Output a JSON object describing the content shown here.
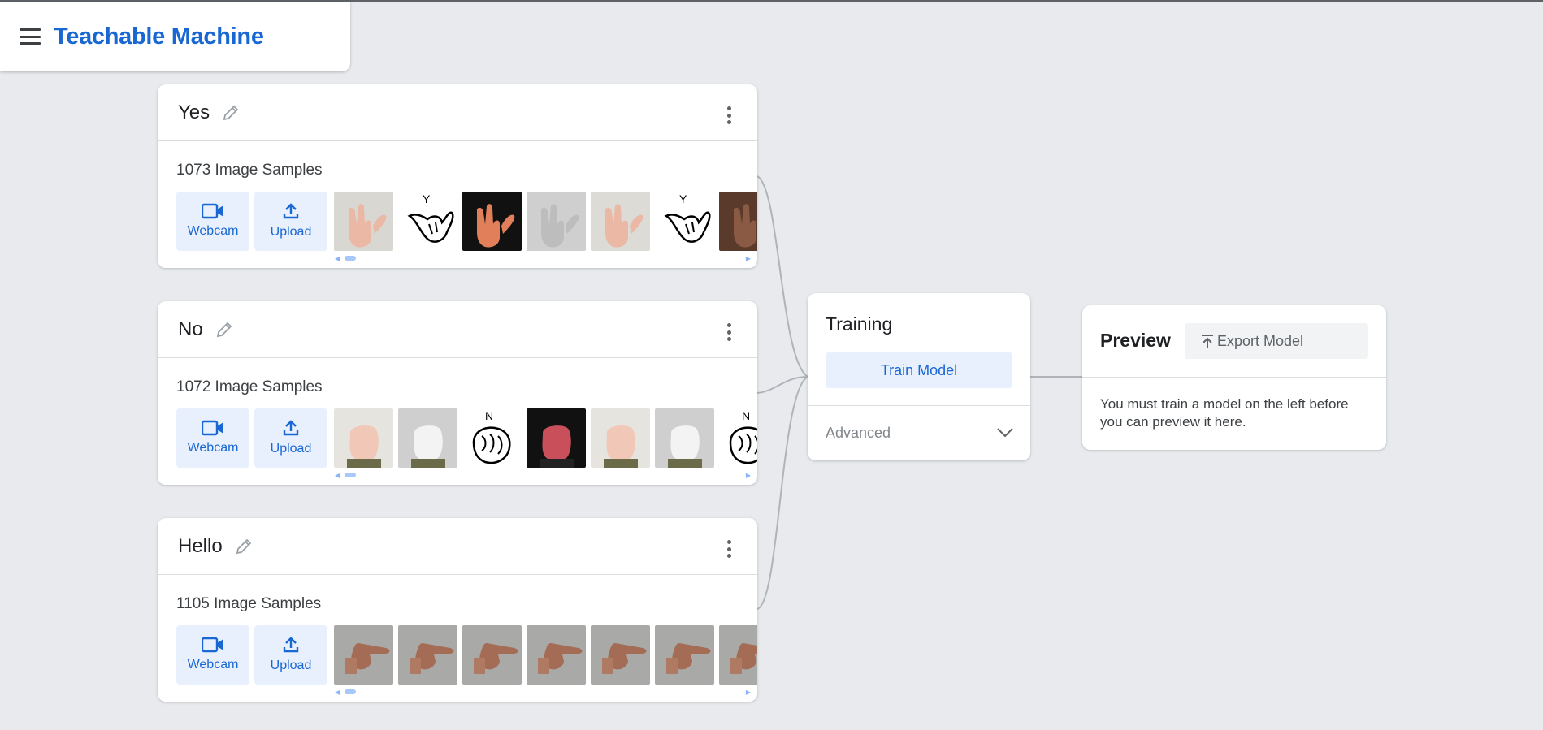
{
  "app": {
    "title": "Teachable Machine"
  },
  "classes": [
    {
      "name": "Yes",
      "sample_count": "1073 Image Samples",
      "webcam_label": "Webcam",
      "upload_label": "Upload"
    },
    {
      "name": "No",
      "sample_count": "1072 Image Samples",
      "webcam_label": "Webcam",
      "upload_label": "Upload"
    },
    {
      "name": "Hello",
      "sample_count": "1105 Image Samples",
      "webcam_label": "Webcam",
      "upload_label": "Upload"
    }
  ],
  "training": {
    "title": "Training",
    "train_button": "Train Model",
    "advanced_label": "Advanced"
  },
  "preview": {
    "title": "Preview",
    "export_button": "Export Model",
    "message": "You must train a model on the left before you can preview it here."
  },
  "thumb_letters": {
    "yes": "Y",
    "no": "N"
  },
  "colors": {
    "accent": "#1967d2",
    "accent_bg": "#e8f0fe",
    "background": "#e8eaed",
    "card": "#ffffff"
  },
  "icons": [
    "menu-icon",
    "pencil-icon",
    "more-vert-icon",
    "webcam-icon",
    "upload-icon",
    "chevron-down-icon",
    "export-icon"
  ]
}
